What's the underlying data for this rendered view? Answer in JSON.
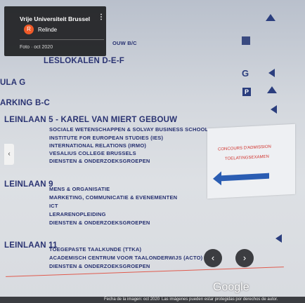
{
  "infocard": {
    "title": "Vrije Universiteit Brussel",
    "avatar_letter": "R",
    "user": "Relinde",
    "date": "Foto · oct 2020",
    "menu_glyph": "⋮"
  },
  "sign": {
    "lines": [
      "LESLOKALEN D-E-F",
      "ULA G",
      "ARKING B-C",
      "LEINLAAN 5 - KAREL VAN MIERT GEBOUW",
      "SOCIALE WETENSCHAPPEN & SOLVAY BUSINESS SCHOOL",
      "INSTITUTE FOR EUROPEAN STUDIES (IES)",
      "INTERNATIONAL RELATIONS (IRMO)",
      "VESALIUS COLLEGE BRUSSELS",
      "DIENSTEN & ONDERZOEKSGROEPEN",
      "LEINLAAN 9",
      "MENS & ORGANISATIE",
      "MARKETING, COMMUNICATIE & EVENEMENTEN",
      "ICT",
      "LERARENOPLEIDING",
      "DIENSTEN & ONDERZOEKSGROEPEN",
      "LEINLAAN 11",
      "TOEGEPASTE TAALKUNDE (TTKA)",
      "ACADEMISCH CENTRUM VOOR TAALONDERWIJS (ACTO)",
      "DIENSTEN & ONDERZOEKSGROEPEN"
    ],
    "partial_top": "OUW B/C",
    "g_badge": "G",
    "p_badge": "P"
  },
  "poster": {
    "line1": "CONCOURS D'ADMISSION",
    "line2": "TOELATINGSEXAMEN"
  },
  "nav": {
    "side_arrow": "‹",
    "prev_arrow": "‹",
    "next_arrow": "›"
  },
  "branding": {
    "google": "Google"
  },
  "footer": {
    "date": "Fecha de la imagen: oct 2020",
    "notice": "Las imágenes pueden estar protegidas por derechos de autor."
  }
}
